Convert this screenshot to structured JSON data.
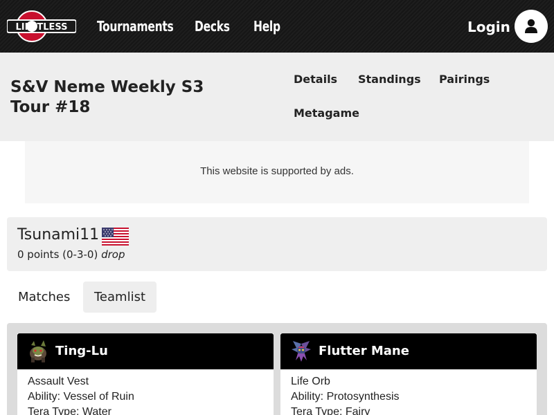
{
  "nav": {
    "logo_text": "LIMITLESS",
    "links": [
      "Tournaments",
      "Decks",
      "Help"
    ],
    "login_label": "Login",
    "user_icon": "user-icon"
  },
  "tournament": {
    "title": "S&V Neme Weekly S3 Tour #18",
    "tabs": [
      "Details",
      "Standings",
      "Pairings",
      "Metagame"
    ]
  },
  "ad": {
    "text": "This website is supported by ads."
  },
  "player": {
    "name": "Tsunami11",
    "flag": "us-flag-icon",
    "record": "0 points (0-3-0)",
    "status": "drop"
  },
  "subtabs": {
    "items": [
      "Matches",
      "Teamlist"
    ],
    "active": "Teamlist"
  },
  "team": [
    {
      "name": "Ting-Lu",
      "sprite": "ting-lu-sprite-icon",
      "item": "Assault Vest",
      "ability": "Ability: Vessel of Ruin",
      "tera": "Tera Type: Water"
    },
    {
      "name": "Flutter Mane",
      "sprite": "flutter-mane-sprite-icon",
      "item": "Life Orb",
      "ability": "Ability: Protosynthesis",
      "tera": "Tera Type: Fairy"
    }
  ],
  "colors": {
    "topbar": "#1a1a1a",
    "header_bg": "#eeeeee",
    "card_head": "#000000",
    "panel_bg": "#dcdcdc"
  }
}
